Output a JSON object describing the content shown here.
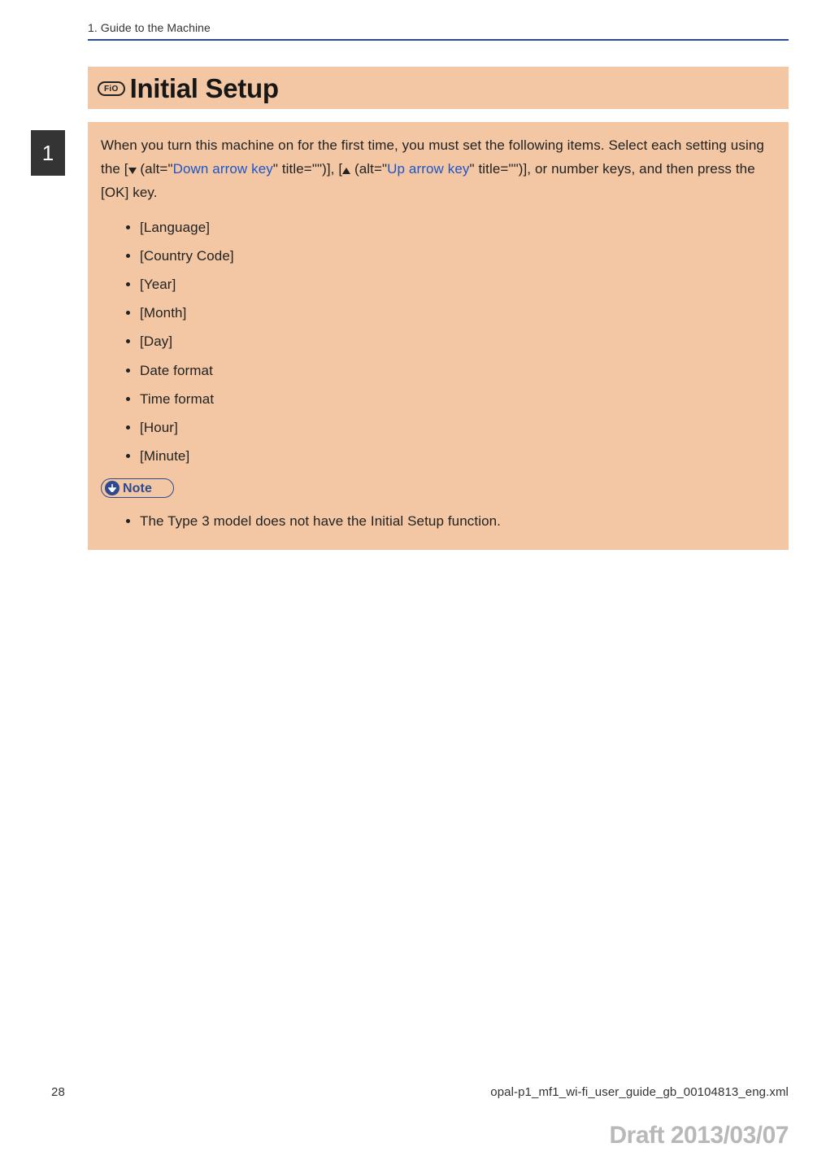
{
  "header": {
    "breadcrumb": "1. Guide to the Machine"
  },
  "side_tab": {
    "number": "1"
  },
  "title": {
    "badge": "FiO",
    "text": "Initial Setup"
  },
  "body": {
    "para_a": "When you turn this machine on for the first time, you must set the following items. Select each setting using the [",
    "para_b": " (alt=\"",
    "link_down": "Down arrow key",
    "para_c": "\" title=\"\")], [",
    "para_d": " (alt=\"",
    "link_up": "Up arrow key",
    "para_e": "\" title=\"\")], or number keys, and then press the [OK] key.",
    "items": [
      "[Language]",
      "[Country Code]",
      "[Year]",
      "[Month]",
      "[Day]",
      "Date format",
      "Time format",
      "[Hour]",
      "[Minute]"
    ]
  },
  "note": {
    "label": "Note",
    "items": [
      "The Type 3 model does not have the Initial Setup function."
    ]
  },
  "footer": {
    "page": "28",
    "filename": "opal-p1_mf1_wi-fi_user_guide_gb_00104813_eng.xml"
  },
  "draft": "Draft 2013/03/07"
}
